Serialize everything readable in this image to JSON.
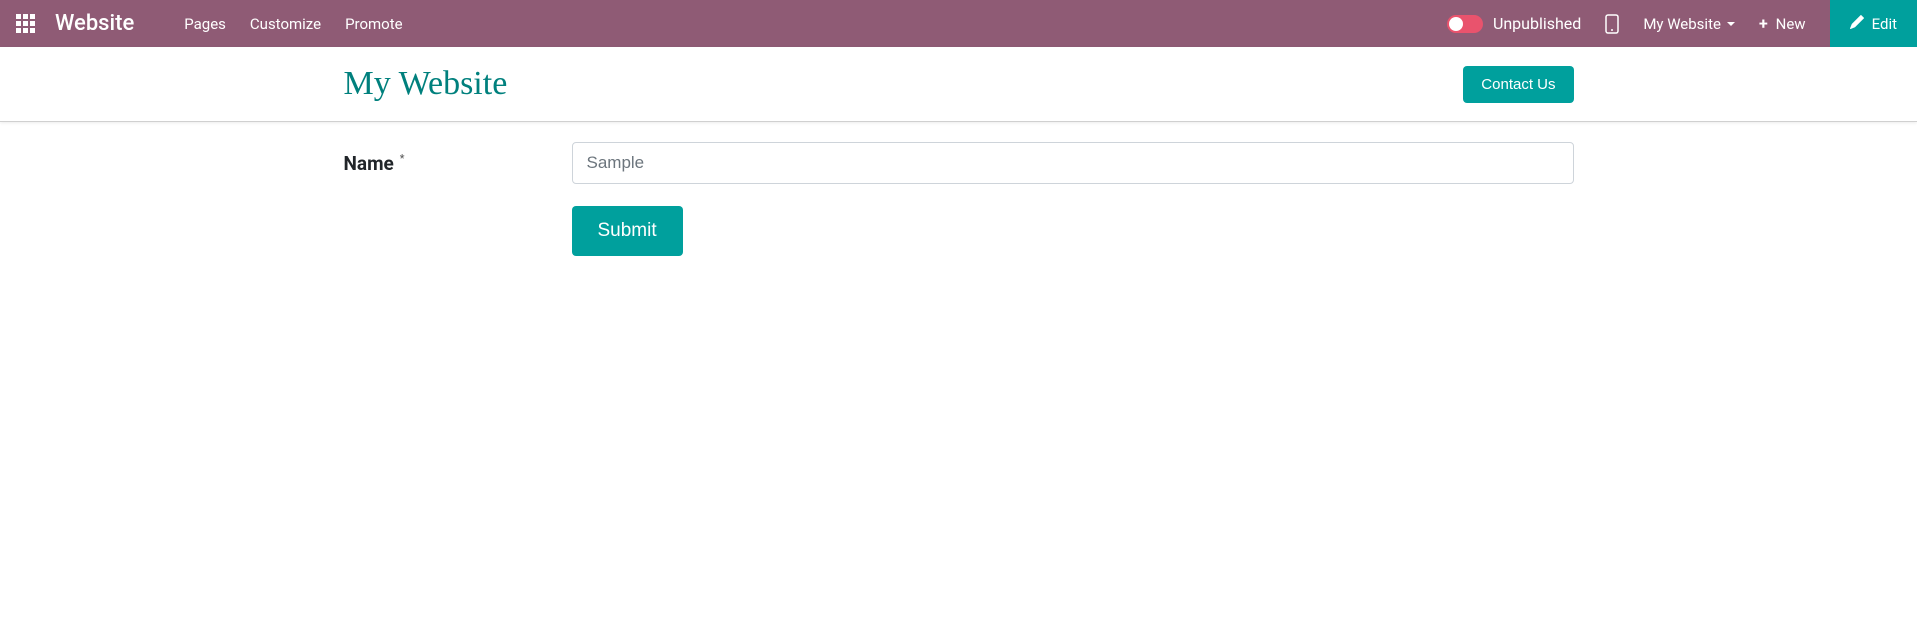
{
  "topnav": {
    "brand": "Website",
    "links": {
      "pages": "Pages",
      "customize": "Customize",
      "promote": "Promote"
    },
    "publish_status": "Unpublished",
    "site_selector": "My Website",
    "new_label": "New",
    "edit_label": "Edit"
  },
  "header": {
    "site_title": "My Website",
    "contact_label": "Contact Us"
  },
  "form": {
    "name_label": "Name",
    "name_placeholder": "Sample",
    "required_mark": "*",
    "submit_label": "Submit"
  }
}
